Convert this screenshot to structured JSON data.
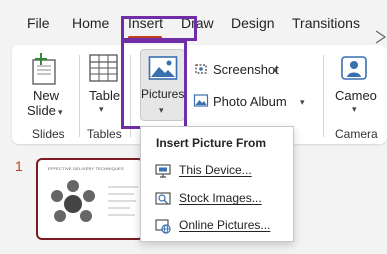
{
  "menu": {
    "file": "File",
    "home": "Home",
    "insert": "Insert",
    "draw": "Draw",
    "design": "Design",
    "transitions": "Transitions"
  },
  "ribbon": {
    "new_slide_line1": "New",
    "new_slide_line2": "Slide",
    "slides_group": "Slides",
    "table": "Table",
    "tables_group": "Tables",
    "pictures": "Pictures",
    "screenshot": "Screenshot",
    "photo_album": "Photo Album",
    "cameo": "Cameo",
    "camera_group": "Camera"
  },
  "dropdown": {
    "header": "Insert Picture From",
    "items": [
      {
        "label": "This Device...",
        "icon": "device-icon"
      },
      {
        "label": "Stock Images...",
        "icon": "stock-images-icon"
      },
      {
        "label": "Online Pictures...",
        "icon": "online-pictures-icon"
      }
    ]
  },
  "slides_panel": {
    "slide_number": "1",
    "thumbnail_title": "EFFECTIVE DELIVERY TECHNIQUES"
  },
  "colors": {
    "accent": "#c43e1c",
    "highlight": "#6f2da8",
    "thumb_border": "#7a1c22"
  }
}
